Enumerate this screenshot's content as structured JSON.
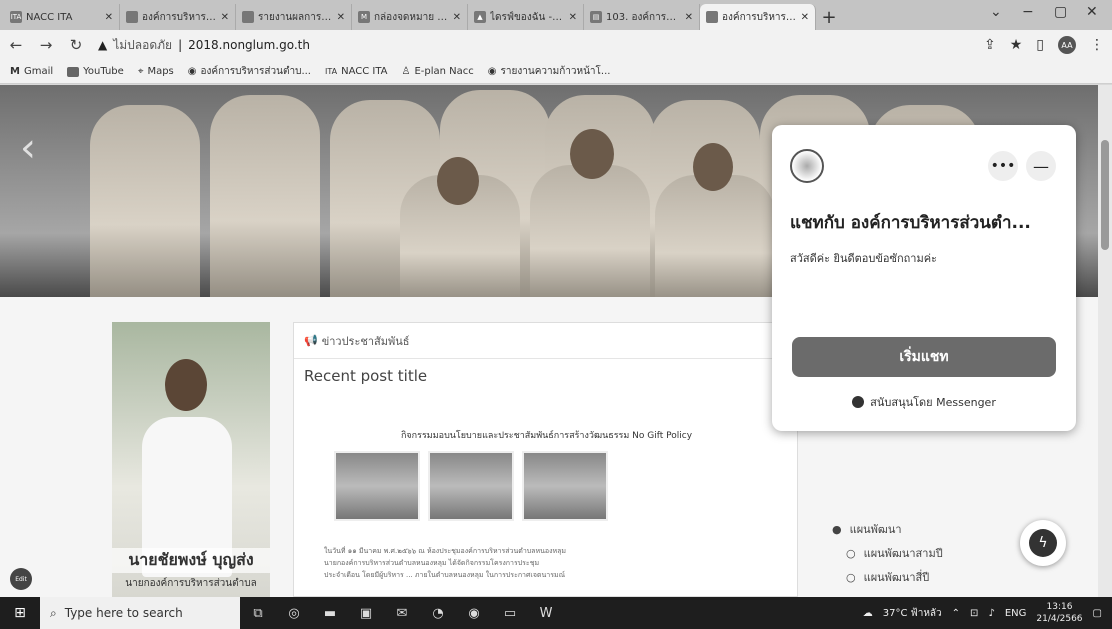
{
  "browser": {
    "tabs": [
      {
        "favicon": "nacc",
        "label": "NACC ITA"
      },
      {
        "favicon": "seal",
        "label": "องค์การบริหารส่วนต..."
      },
      {
        "favicon": "seal",
        "label": "รายงานผลการดำเนิ..."
      },
      {
        "favicon": "gmail",
        "label": "กล่องจดหมาย (23..."
      },
      {
        "favicon": "drive",
        "label": "ไดรฟ์ของฉัน - Goo..."
      },
      {
        "favicon": "doc",
        "label": "103. องค์การบริหา..."
      },
      {
        "favicon": "seal",
        "label": "องค์การบริหารส่วนต..."
      }
    ],
    "new_tab": "+",
    "window_controls": {
      "minimize": "−",
      "maximize": "▢",
      "close": "✕",
      "chevron": "⌄"
    },
    "address": {
      "security": "ไม่ปลอดภัย",
      "url": "2018.nonglum.go.th"
    },
    "bookmarks": [
      "Gmail",
      "YouTube",
      "Maps",
      "องค์การบริหารส่วนตำบ...",
      "NACC ITA",
      "E-plan Nacc",
      "รายงานความก้าวหน้าโ..."
    ],
    "profile_initials": "AA"
  },
  "hero": {
    "prev": "‹",
    "next": "›"
  },
  "profile": {
    "name": "นายชัยพงษ์ บุญส่ง",
    "role": "นายกองค์การบริหารส่วนตำบล"
  },
  "news": {
    "section_label": "ข่าวประชาสัมพันธ์",
    "post_title": "Recent post title",
    "post_heading": "กิจกรรมมอบนโยบายและประชาสัมพันธ์การสร้างวัฒนธรรม No Gift Policy",
    "body_line1": "ในวันที่ ๑๑ มีนาคม พ.ศ.๒๕๖๖ ณ ห้องประชุมองค์การบริหารส่วนตำบลหนองหลุม",
    "body_line2": "นายกองค์การบริหารส่วนตำบลหนองหลุม ได้จัดกิจกรรมโครงการประชุม",
    "body_line3": "ประจำเดือน โดยมีผู้บริหาร ... ภายในตำบลหนองหลุม ในการประกาศเจตนารมณ์"
  },
  "sidebar_links": [
    {
      "level": 1,
      "label": "แผนพัฒนา"
    },
    {
      "level": 2,
      "label": "แผนพัฒนาสามปี"
    },
    {
      "level": 2,
      "label": "แผนพัฒนาสี่ปี"
    }
  ],
  "chat": {
    "title": "แชทกับ องค์การบริหารส่วนตำ...",
    "greeting": "สวัสดีค่ะ ยินดีตอบข้อซักถามค่ะ",
    "start_button": "เริ่มแชท",
    "powered_by": "สนับสนุนโดย Messenger",
    "more": "•••",
    "minimize": "—"
  },
  "edit_badge": "Edit",
  "taskbar": {
    "search_placeholder": "Type here to search",
    "weather": "37°C ฟ้าหลัว",
    "language": "ENG",
    "time": "13:16",
    "date": "21/4/2566"
  }
}
